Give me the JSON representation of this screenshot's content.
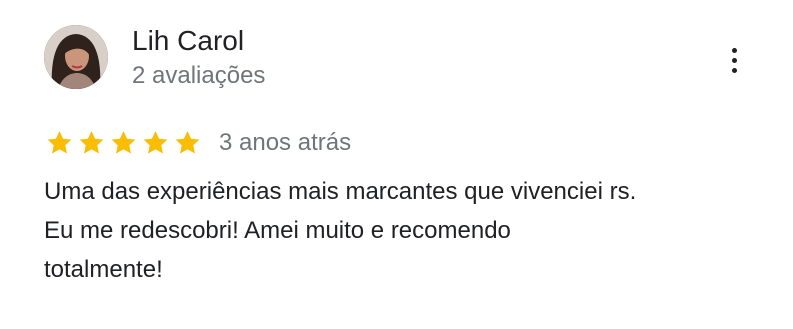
{
  "reviewer": {
    "name": "Lih Carol",
    "review_count": "2 avaliações",
    "avatar": "profile-photo"
  },
  "menu": {
    "icon": "more-vert-icon"
  },
  "rating": {
    "stars": 5,
    "max_stars": 5,
    "star_color": "#fbbc04",
    "date": "3 anos atrás"
  },
  "review": {
    "lines": [
      "Uma das experiências mais marcantes que vivenciei rs.",
      "Eu me redescobri! Amei muito e recomendo",
      "totalmente!"
    ]
  },
  "colors": {
    "primary_text": "#202124",
    "secondary_text": "#70757a"
  }
}
